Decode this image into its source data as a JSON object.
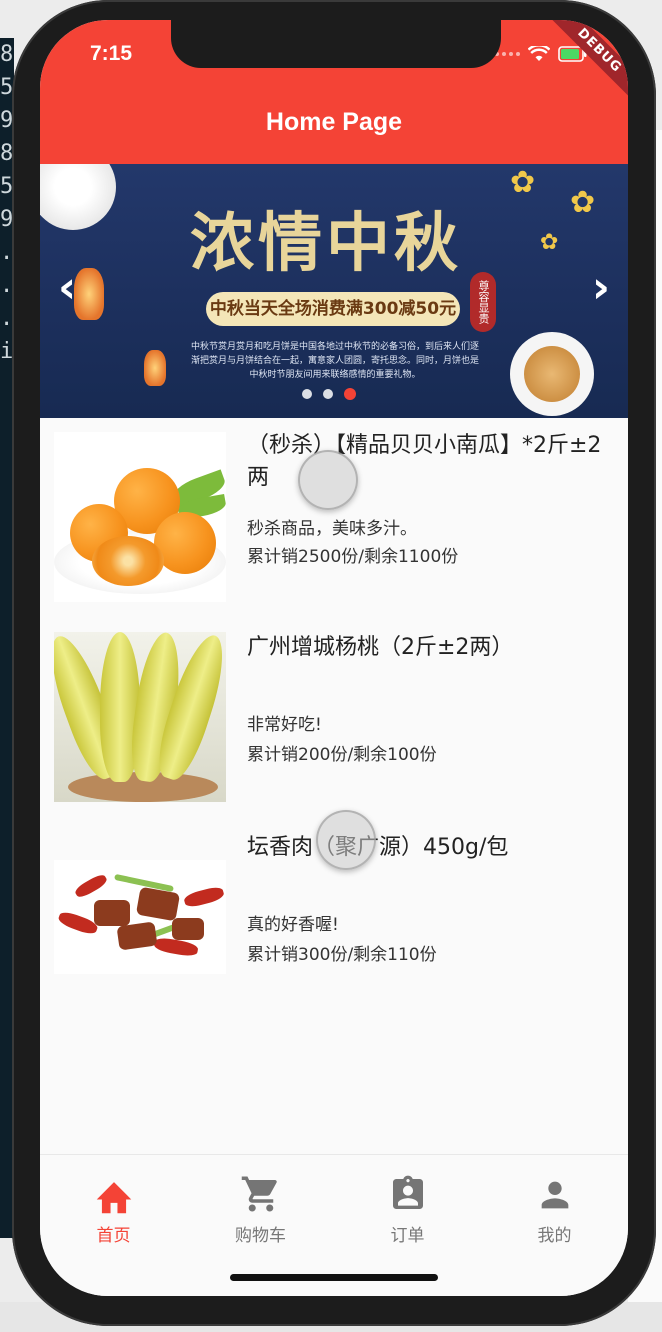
{
  "status_bar": {
    "time": "7:15",
    "debug_badge": "DEBUG"
  },
  "app_bar": {
    "title": "Home Page"
  },
  "banner": {
    "headline": "浓情中秋",
    "promo": "中秋当天全场消费满300减50元",
    "seal_text": "尊容显贵",
    "description": "中秋节赏月赏月和吃月饼是中国各地过中秋节的必备习俗，到后来人们逐渐把赏月与月饼结合在一起，寓意家人团圆，寄托思念。同时，月饼也是中秋时节朋友间用来联络感情的重要礼物。",
    "prev_label": "‹",
    "next_label": "›",
    "page_count": 3,
    "active_page": 2
  },
  "products": [
    {
      "title": "（秒杀）【精品贝贝小南瓜】*2斤±2两",
      "subtitle": "秒杀商品，美味多汁。",
      "sales": "累计销2500份/剩余1100份",
      "image": "oranges"
    },
    {
      "title": "广州增城杨桃（2斤±2两）",
      "subtitle": "非常好吃!",
      "sales": "累计销200份/剩余100份",
      "image": "starfruit"
    },
    {
      "title": "坛香肉（聚广源）450g/包",
      "subtitle": "真的好香喔!",
      "sales": "累计销300份/剩余110份",
      "image": "braised-pork"
    }
  ],
  "bottom_nav": [
    {
      "label": "首页",
      "icon": "home-icon",
      "active": true
    },
    {
      "label": "购物车",
      "icon": "cart-icon",
      "active": false
    },
    {
      "label": "订单",
      "icon": "order-icon",
      "active": false
    },
    {
      "label": "我的",
      "icon": "person-icon",
      "active": false
    }
  ],
  "colors": {
    "primary": "#f44336",
    "nav_inactive": "#777777",
    "banner_bg": "#1c2f5c"
  }
}
